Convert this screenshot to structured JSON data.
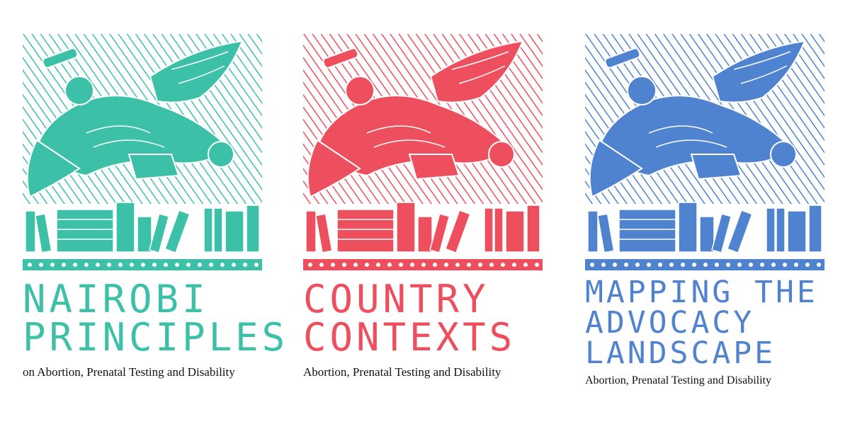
{
  "colors": {
    "teal": "#3cc0a8",
    "red": "#ee4f5f",
    "blue": "#4f83cf"
  },
  "covers": [
    {
      "title_lines": [
        "NAIROBI",
        "PRINCIPLES"
      ],
      "subtitle": "on Abortion, Prenatal Testing and Disability",
      "illustration": "winged-creature-with-bookshelf-icon"
    },
    {
      "title_lines": [
        "COUNTRY",
        "CONTEXTS"
      ],
      "subtitle": "Abortion, Prenatal Testing and Disability",
      "illustration": "winged-creature-with-bookshelf-icon"
    },
    {
      "title_lines": [
        "MAPPING THE",
        "ADVOCACY",
        "LANDSCAPE"
      ],
      "subtitle": "Abortion, Prenatal Testing and Disability",
      "illustration": "winged-creature-with-bookshelf-icon"
    }
  ]
}
